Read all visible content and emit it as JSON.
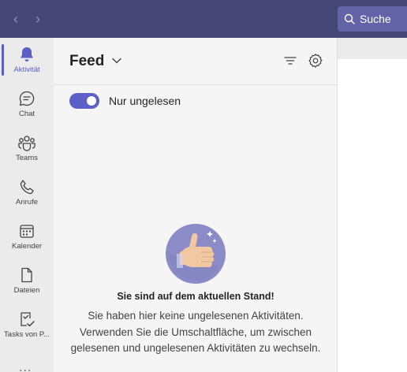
{
  "titlebar": {
    "search_placeholder": "Suche"
  },
  "rail": {
    "items": [
      {
        "label": "Aktivität",
        "icon": "bell-icon",
        "active": true
      },
      {
        "label": "Chat",
        "icon": "chat-icon"
      },
      {
        "label": "Teams",
        "icon": "teams-icon"
      },
      {
        "label": "Anrufe",
        "icon": "phone-icon"
      },
      {
        "label": "Kalender",
        "icon": "calendar-icon"
      },
      {
        "label": "Dateien",
        "icon": "file-icon"
      },
      {
        "label": "Tasks von P...",
        "icon": "tasks-icon"
      }
    ],
    "more_label": "..."
  },
  "feed": {
    "title": "Feed",
    "toggle_label": "Nur ungelesen",
    "toggle_on": true,
    "empty_title": "Sie sind auf dem aktuellen Stand!",
    "empty_body": "Sie haben hier keine ungelesenen Aktivitäten. Verwenden Sie die Umschaltfläche, um zwischen gelesenen und ungelesenen Aktivitäten zu wechseln."
  },
  "colors": {
    "titlebar": "#464775",
    "accent": "#5b5fc7",
    "search_bg": "#6264a7"
  }
}
